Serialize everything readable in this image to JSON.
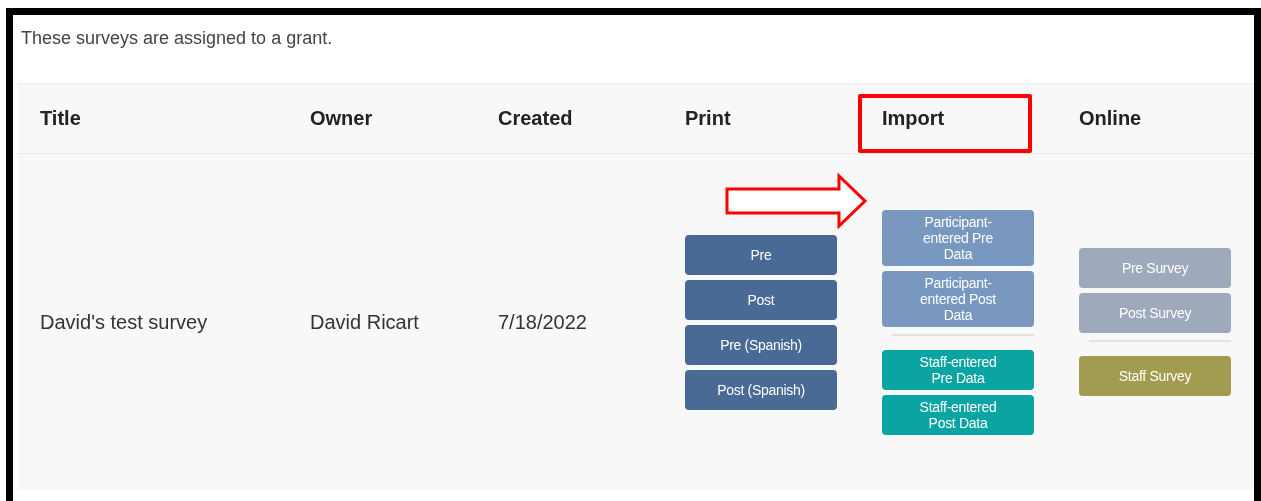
{
  "intro": "These surveys are assigned to a grant.",
  "table": {
    "columns": [
      "Title",
      "Owner",
      "Created",
      "Print",
      "Import",
      "Online"
    ],
    "rows": [
      {
        "title": "David's test survey",
        "owner": "David Ricart",
        "created": "7/18/2022",
        "print": [
          [
            {
              "label": "Pre",
              "kind": "print"
            },
            {
              "label": "Post",
              "kind": "print"
            },
            {
              "label": "Pre (Spanish)",
              "kind": "print"
            },
            {
              "label": "Post (Spanish)",
              "kind": "print"
            }
          ]
        ],
        "import": [
          [
            {
              "label": "Participant-entered Pre Data",
              "kind": "participant"
            },
            {
              "label": "Participant-entered Post Data",
              "kind": "participant"
            }
          ],
          [
            {
              "label": "Staff-entered Pre Data",
              "kind": "staff"
            },
            {
              "label": "Staff-entered Post Data",
              "kind": "staff"
            }
          ]
        ],
        "online": [
          [
            {
              "label": "Pre Survey",
              "kind": "online"
            },
            {
              "label": "Post Survey",
              "kind": "online"
            }
          ],
          [
            {
              "label": "Staff Survey",
              "kind": "staff-online"
            }
          ]
        ]
      }
    ]
  }
}
